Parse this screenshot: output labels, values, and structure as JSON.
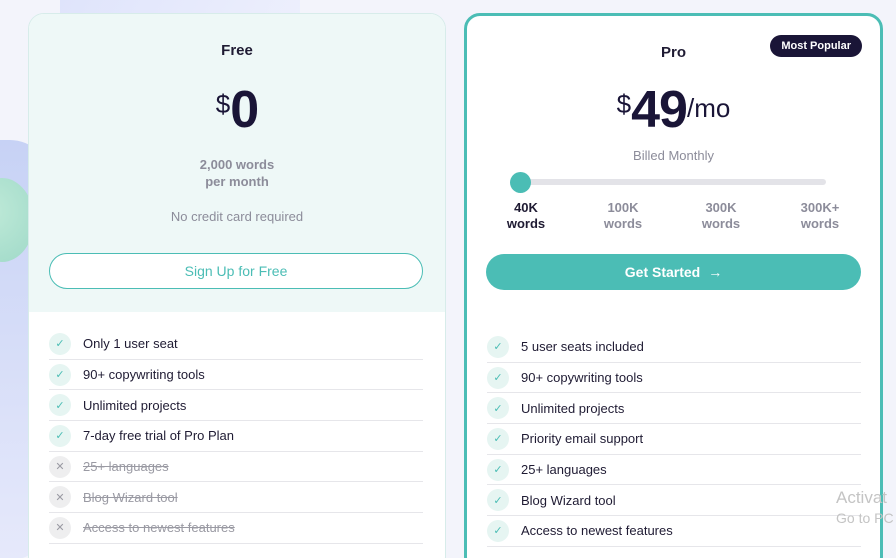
{
  "free": {
    "name": "Free",
    "currency": "$",
    "price": "0",
    "words": "2,000 words",
    "period": "per month",
    "note": "No credit card required",
    "cta": "Sign Up for Free",
    "features": [
      {
        "label": "Only 1 user seat",
        "included": true
      },
      {
        "label": "90+ copywriting tools",
        "included": true
      },
      {
        "label": "Unlimited projects",
        "included": true
      },
      {
        "label": "7-day free trial of Pro Plan",
        "included": true
      },
      {
        "label": "25+ languages",
        "included": false
      },
      {
        "label": "Blog Wizard tool",
        "included": false
      },
      {
        "label": "Access to newest features",
        "included": false
      }
    ]
  },
  "pro": {
    "name": "Pro",
    "badge": "Most Popular",
    "currency": "$",
    "price": "49",
    "per": "/mo",
    "billing": "Billed Monthly",
    "slider": {
      "selected_index": 0,
      "options": [
        {
          "amount": "40K",
          "unit": "words"
        },
        {
          "amount": "100K",
          "unit": "words"
        },
        {
          "amount": "300K",
          "unit": "words"
        },
        {
          "amount": "300K+",
          "unit": "words"
        }
      ]
    },
    "cta": "Get Started",
    "features": [
      {
        "label": "5 user seats included",
        "included": true
      },
      {
        "label": "90+ copywriting tools",
        "included": true
      },
      {
        "label": "Unlimited projects",
        "included": true
      },
      {
        "label": "Priority email support",
        "included": true
      },
      {
        "label": "25+ languages",
        "included": true
      },
      {
        "label": "Blog Wizard tool",
        "included": true
      },
      {
        "label": "Access to newest features",
        "included": true
      }
    ]
  },
  "icons": {
    "check": "check-icon",
    "cross": "cross-icon",
    "arrow": "arrow-right-icon"
  },
  "colors": {
    "accent": "#4bbdb5",
    "dark": "#1a1537",
    "muted": "#8c8c9a"
  },
  "watermark": {
    "line1": "Activat",
    "line2": "Go to PC"
  }
}
